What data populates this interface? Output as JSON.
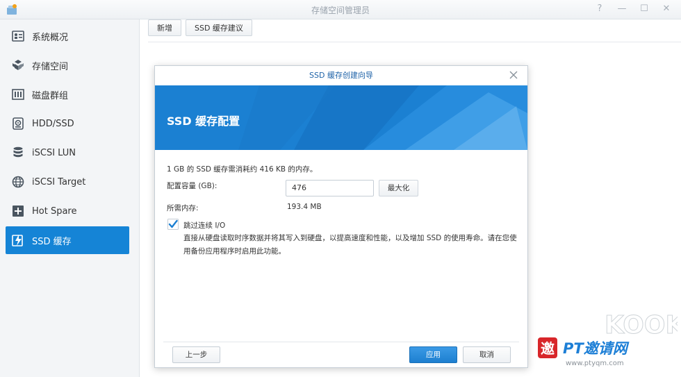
{
  "window": {
    "title": "存储空间管理员",
    "controls": [
      "?",
      "—",
      "☐",
      "✕"
    ]
  },
  "sidebar": {
    "items": [
      {
        "label": "系统概况",
        "icon": "overview-icon"
      },
      {
        "label": "存储空间",
        "icon": "storage-icon"
      },
      {
        "label": "磁盘群组",
        "icon": "disk-group-icon"
      },
      {
        "label": "HDD/SSD",
        "icon": "hdd-icon"
      },
      {
        "label": "iSCSI LUN",
        "icon": "database-icon"
      },
      {
        "label": "iSCSI Target",
        "icon": "globe-icon"
      },
      {
        "label": "Hot Spare",
        "icon": "plus-box-icon"
      },
      {
        "label": "SSD 缓存",
        "icon": "ssd-cache-icon",
        "active": true
      }
    ]
  },
  "toolbar": {
    "add_label": "新增",
    "advisor_label": "SSD 缓存建议"
  },
  "dialog": {
    "title": "SSD 缓存创建向导",
    "banner_title": "SSD 缓存配置",
    "info_text": "1 GB 的 SSD 缓存需消耗约 416 KB 的内存。",
    "capacity_label": "配置容量 (GB):",
    "capacity_value": "476",
    "max_label": "最大化",
    "memory_label": "所需内存:",
    "memory_value": "193.4 MB",
    "skip_io_label": "跳过连续 I/O",
    "skip_io_checked": true,
    "skip_io_desc": "直接从硬盘读取时序数据并将其写入到硬盘，以提高速度和性能，以及增加 SSD 的使用寿命。请在您使用备份应用程序时启用此功能。",
    "back_label": "上一步",
    "apply_label": "应用",
    "cancel_label": "取消"
  },
  "watermark": {
    "brand": "KOOK",
    "text": "PT邀请网",
    "url": "www.ptyqm.com"
  },
  "colors": {
    "accent": "#1584d6",
    "banner": "#1a7fd1",
    "title_text": "#1f63a8"
  }
}
